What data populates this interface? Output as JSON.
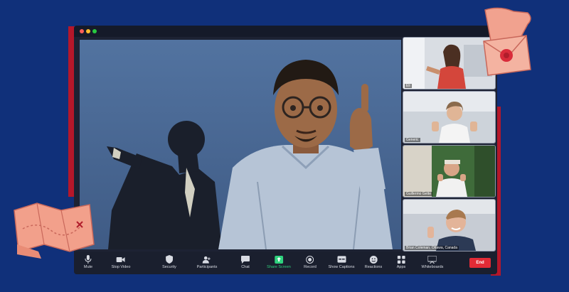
{
  "window": {
    "participants": [
      {
        "name": "Eli"
      },
      {
        "name": "Generic"
      },
      {
        "name": "Guillermo Gette"
      },
      {
        "name": "Brian Coleman, Ottawa, Canada"
      }
    ]
  },
  "toolbar": {
    "items": [
      {
        "label": "Mute",
        "icon": "microphone-icon"
      },
      {
        "label": "Stop Video",
        "icon": "video-camera-icon"
      },
      {
        "label": "Security",
        "icon": "shield-icon"
      },
      {
        "label": "Participants",
        "icon": "participants-icon"
      },
      {
        "label": "Chat",
        "icon": "chat-bubble-icon"
      },
      {
        "label": "Share Screen",
        "icon": "share-screen-icon"
      },
      {
        "label": "Record",
        "icon": "record-icon"
      },
      {
        "label": "Show Captions",
        "icon": "captions-icon"
      },
      {
        "label": "Reactions",
        "icon": "smiley-icon"
      },
      {
        "label": "Apps",
        "icon": "apps-icon"
      },
      {
        "label": "Whiteboards",
        "icon": "whiteboard-icon"
      }
    ],
    "end_label": "End"
  },
  "colors": {
    "background": "#10307a",
    "accent_red": "#b5172a",
    "share_green": "#2fd37e",
    "end_red": "#e22b36"
  }
}
